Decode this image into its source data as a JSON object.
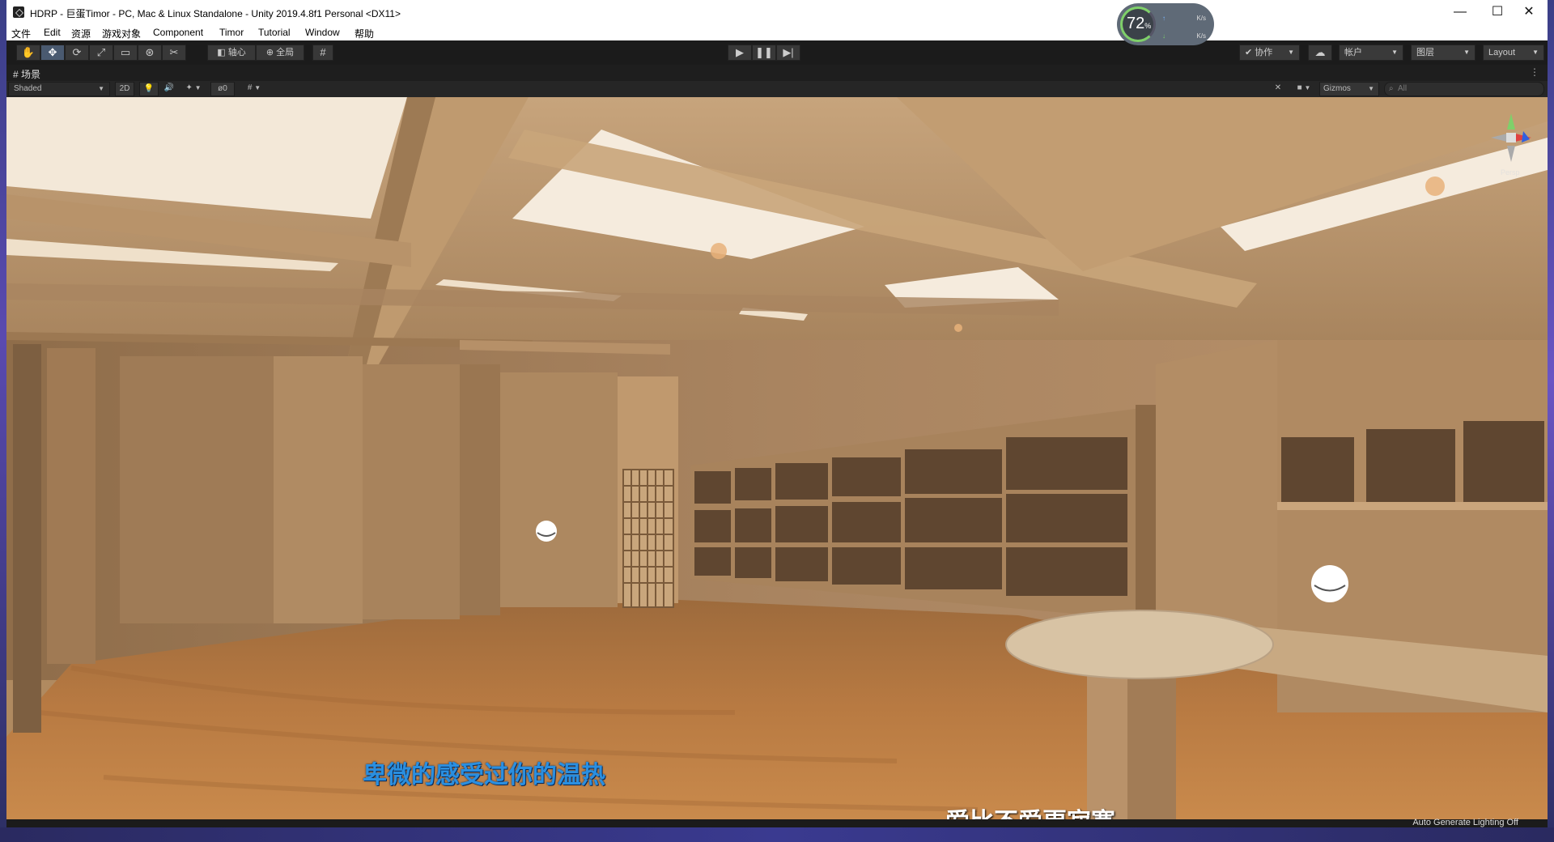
{
  "window": {
    "title": "HDRP - 巨蛋Timor - PC, Mac & Linux Standalone - Unity 2019.4.8f1 Personal <DX11>",
    "minimize": "—",
    "maximize": "☐",
    "close": "✕"
  },
  "net_widget": {
    "percent": "72",
    "percent_unit": "%",
    "up_rate": "K/s",
    "down_rate": "K/s"
  },
  "menu": {
    "items": [
      "文件",
      "Edit",
      "资源",
      "游戏对象",
      "Component",
      "Timor",
      "Tutorial",
      "Window",
      "帮助"
    ]
  },
  "toolbar": {
    "tools": [
      "hand-tool",
      "move-tool",
      "rotate-tool",
      "scale-tool",
      "rect-tool",
      "transform-tool",
      "custom-tool"
    ],
    "pivot_label": "轴心",
    "global_label": "全局",
    "collab_label": "协作",
    "account_label": "帐户",
    "layers_label": "图层",
    "layout_label": "Layout"
  },
  "scene_tab": {
    "label": "场景"
  },
  "scene_toolbar": {
    "draw_mode": "Shaded",
    "mode_2d": "2D",
    "hidden_count": "0",
    "gizmos_label": "Gizmos",
    "search_placeholder": "All"
  },
  "viewport": {
    "subtitle_1": "卑微的感受过你的温热",
    "subtitle_2": "爱比不爱更寂寞",
    "gizmo_x": "x",
    "gizmo_y": "y",
    "gizmo_persp": "Persp"
  },
  "status": {
    "text": "Auto Generate Lighting Off"
  },
  "colors": {
    "wall": "#b08a60",
    "ceiling_light": "#f3e8d8",
    "floor": "#b5773e",
    "subtitle_blue": "#2a8fe0"
  }
}
